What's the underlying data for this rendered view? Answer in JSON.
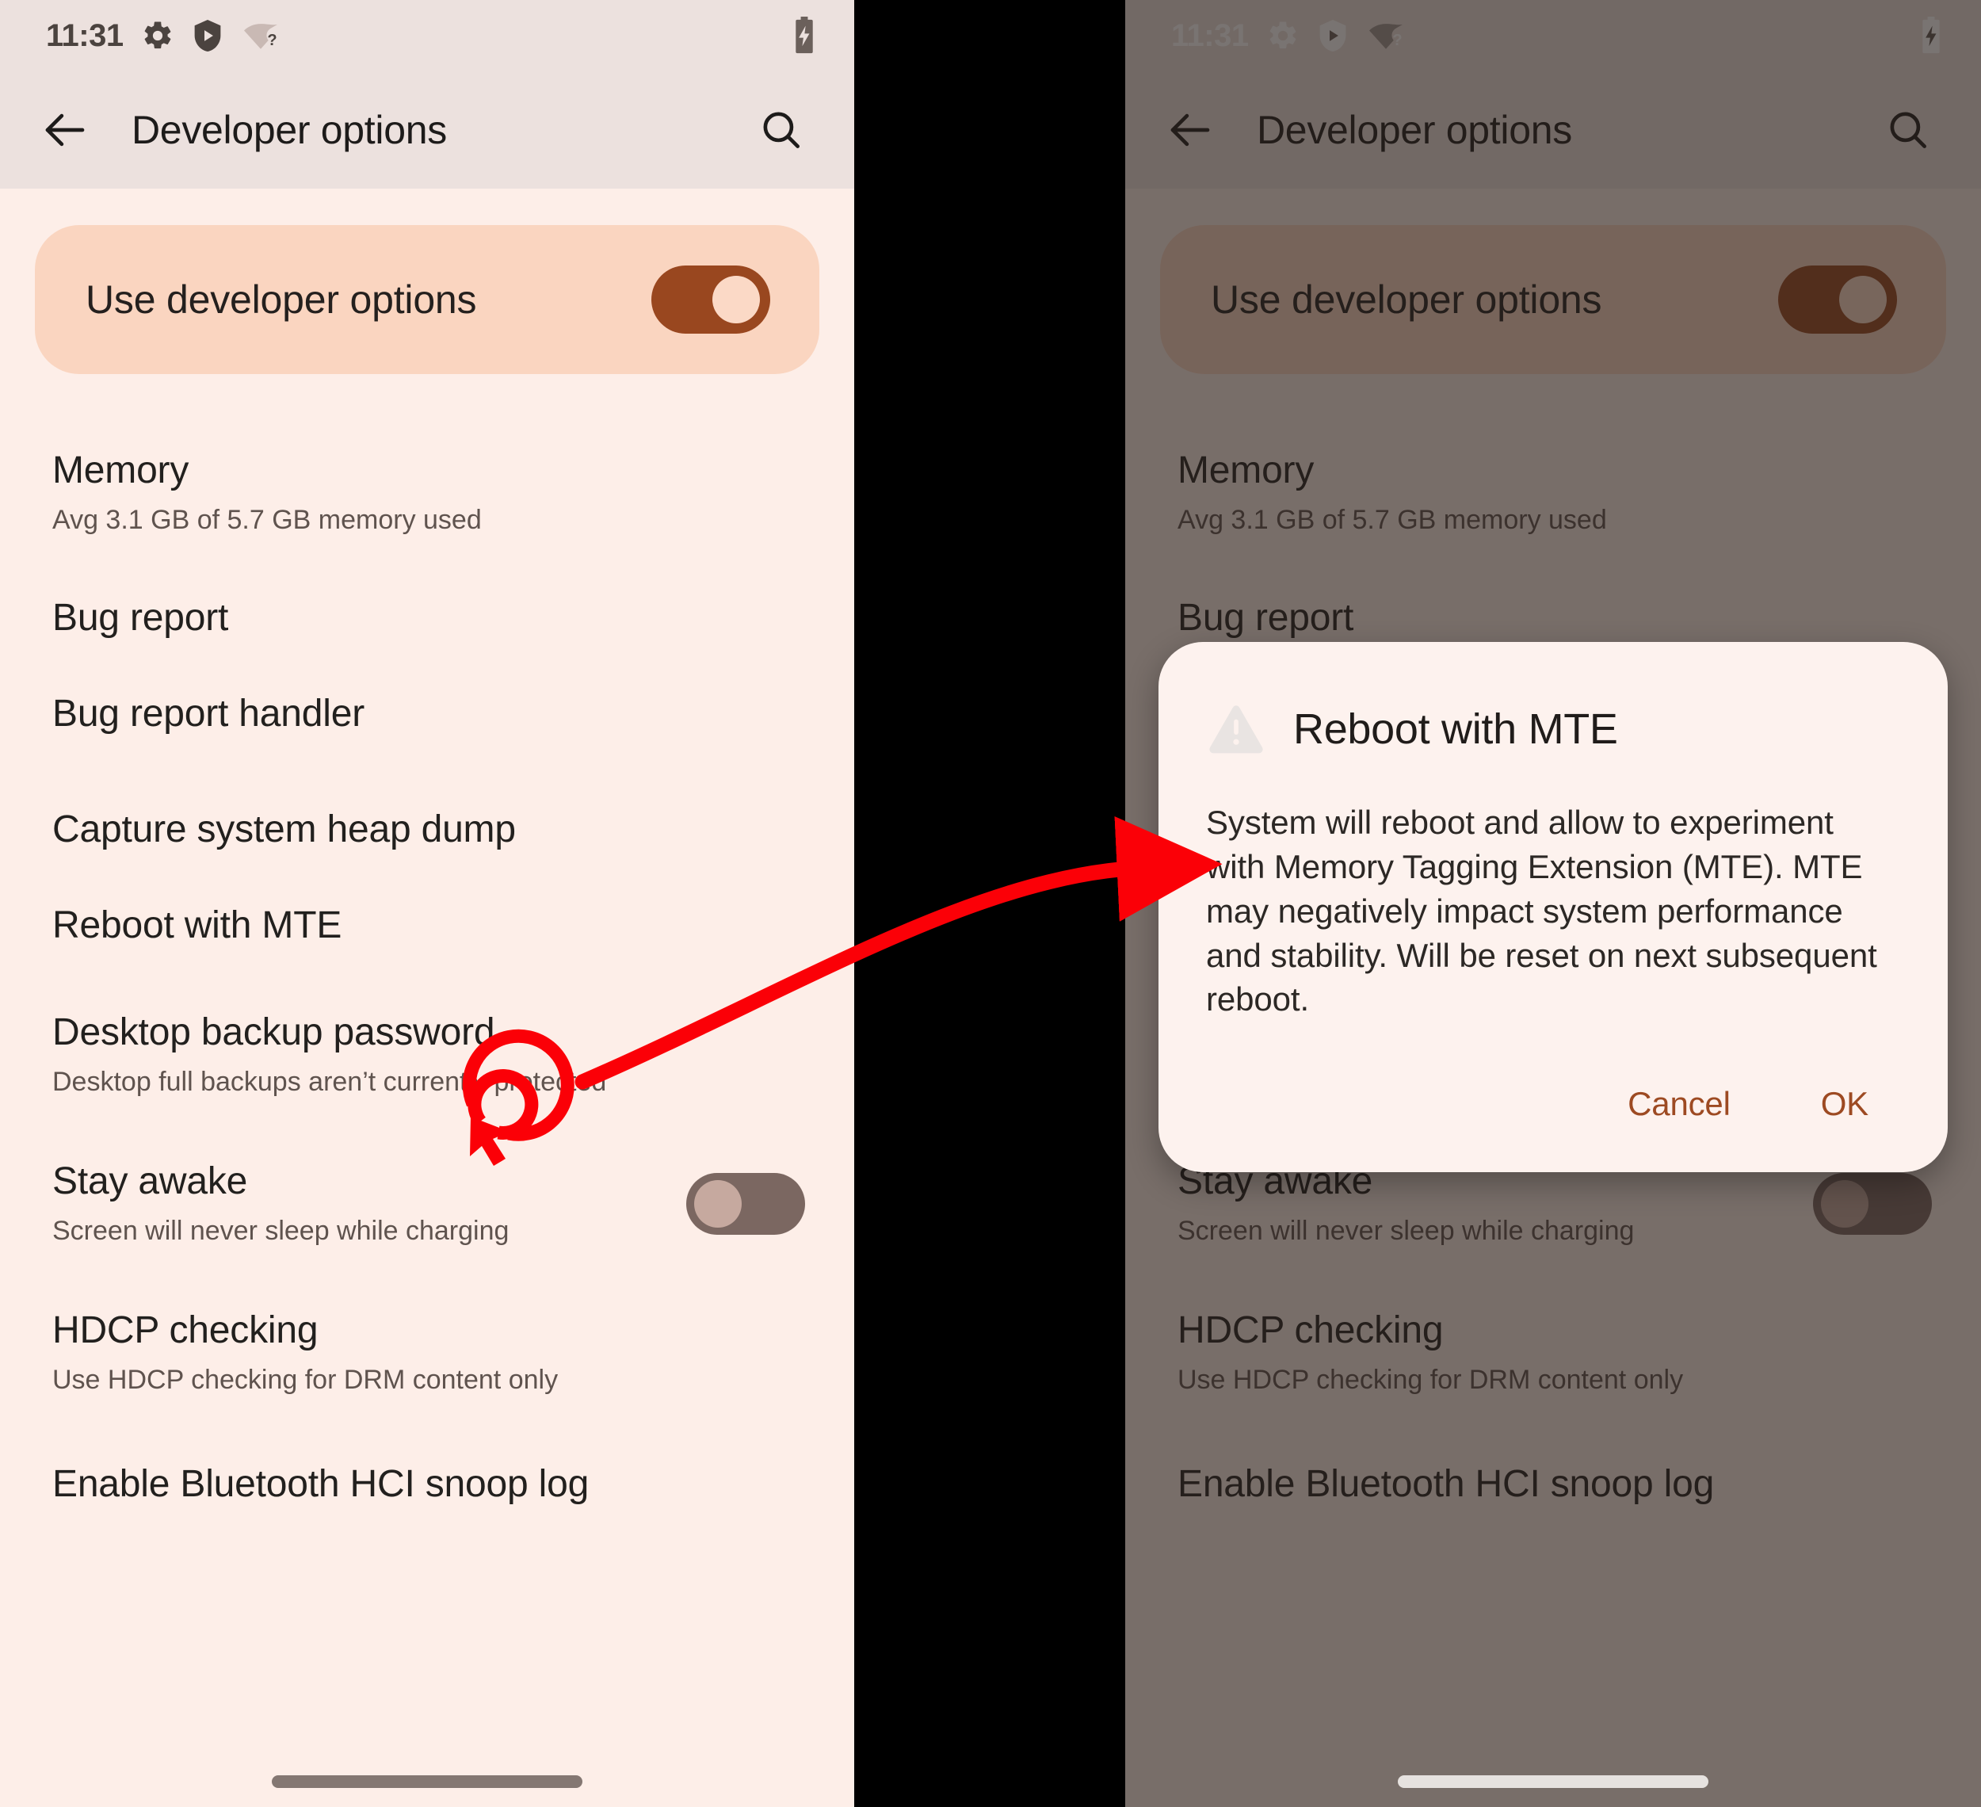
{
  "accent": {
    "brown": "#99471f",
    "annotation_red": "#fb0007",
    "body_bg": "#fdeee8",
    "bar_bg": "#ece1de",
    "card_bg": "#fad5c0",
    "dialog_bg": "#fdf2ee",
    "scrim": "rgba(38,30,28,0.62)"
  },
  "statusbar": {
    "time": "11:31",
    "icons": [
      "gear-icon",
      "shield-play-icon",
      "wifi-question-icon"
    ],
    "battery_icon": "battery-charging-icon"
  },
  "appbar": {
    "back_icon": "back-arrow-icon",
    "title": "Developer options",
    "search_icon": "search-icon"
  },
  "master_toggle": {
    "label": "Use developer options",
    "state": "on",
    "icon": "toggle-switch-on-icon"
  },
  "settings_rows": [
    {
      "title": "Memory",
      "subtitle": "Avg 3.1 GB of 5.7 GB memory used",
      "control": "none"
    },
    {
      "title": "Bug report",
      "subtitle": "",
      "control": "none"
    },
    {
      "title": "Bug report handler",
      "subtitle": "",
      "control": "none"
    },
    {
      "title": "Capture system heap dump",
      "subtitle": "",
      "control": "none"
    },
    {
      "title": "Reboot with MTE",
      "subtitle": "",
      "control": "none"
    },
    {
      "title": "Desktop backup password",
      "subtitle": "Desktop full backups aren’t currently protected",
      "control": "none"
    },
    {
      "title": "Stay awake",
      "subtitle": "Screen will never sleep while charging",
      "control": "switch-off"
    },
    {
      "title": "HDCP checking",
      "subtitle": "Use HDCP checking for DRM content only",
      "control": "none"
    },
    {
      "title": "Enable Bluetooth HCI snoop log",
      "subtitle": "",
      "control": "none"
    }
  ],
  "dialog": {
    "icon": "warning-triangle-icon",
    "title": "Reboot with MTE",
    "body": "System will reboot and allow to experiment with Memory Tagging Extension (MTE). MTE may negatively impact system performance and stability. Will be reset on next subsequent reboot.",
    "cancel_label": "Cancel",
    "ok_label": "OK"
  },
  "annotation": {
    "click_target_icon": "click-target-cursor-icon",
    "arrow_icon": "curved-arrow-icon",
    "color": "#fb0007"
  }
}
